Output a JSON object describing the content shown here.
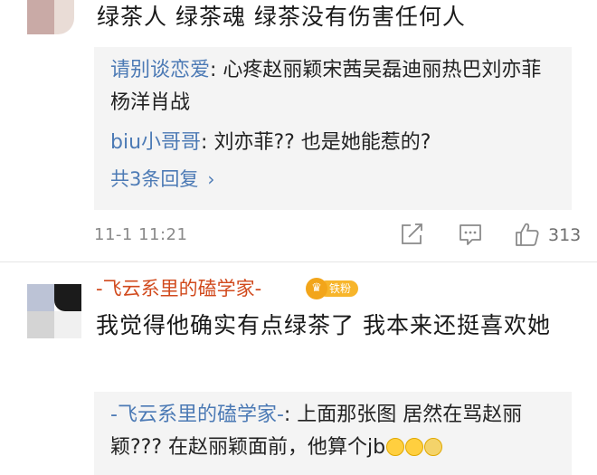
{
  "comment_1": {
    "text": "绿茶人 绿茶魂 绿茶没有伤害任何人",
    "replies": [
      {
        "user": "请别谈恋爱",
        "sep": ": ",
        "text": "心疼赵丽颖宋茜吴磊迪丽热巴刘亦菲杨洋肖战"
      },
      {
        "user": "biu小哥哥",
        "sep": ": ",
        "text": "刘亦菲?? 也是她能惹的?"
      }
    ],
    "more_replies": "共3条回复",
    "time": "11-1 11:21",
    "like_count": "313"
  },
  "comment_2": {
    "username": "-飞云系里的磕学家-",
    "fan_badge": "铁粉",
    "text": "我觉得他确实有点绿茶了 我本来还挺喜欢她",
    "replies": [
      {
        "user": "-飞云系里的磕学家-",
        "sep": ": ",
        "text": "上面那张图 居然在骂赵丽颖??? 在赵丽颖面前，他算个jb"
      }
    ]
  },
  "icons": {
    "share": "share-icon",
    "comment": "comment-icon",
    "like": "thumbs-up-icon",
    "chevron": "chevron-right-icon",
    "crown": "crown-icon",
    "emoji": "sweat-smile-emoji-icon"
  },
  "colors": {
    "username_link": "#4c7ab5",
    "fan_username": "#d14a1d",
    "badge": "#f7b52b",
    "reply_bg": "#f4f4f4",
    "meta": "#8a8a8a"
  }
}
